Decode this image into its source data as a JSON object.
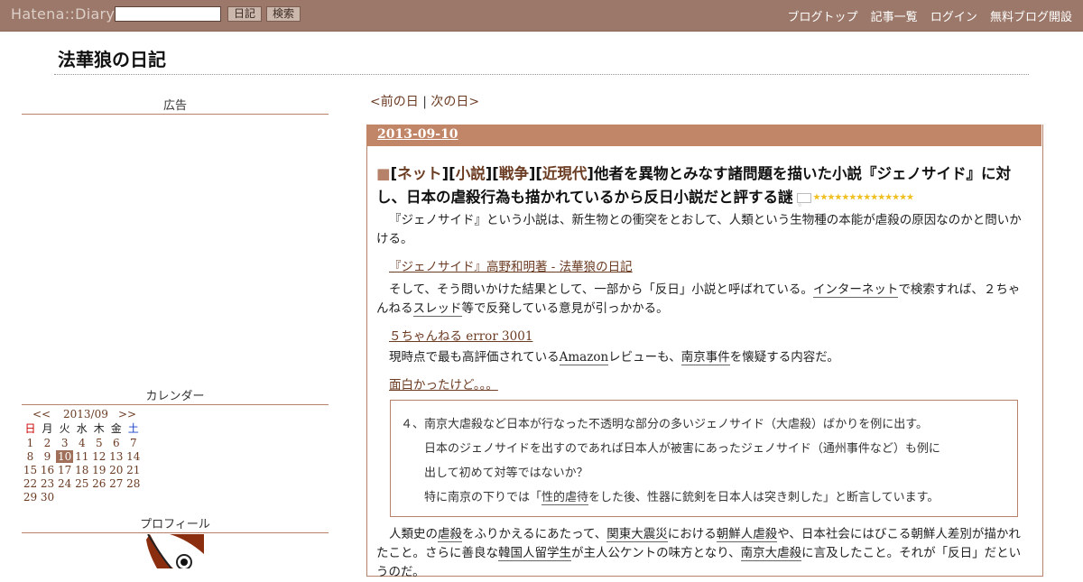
{
  "header": {
    "logo": "Hatena::Diary",
    "diary_button": "日記",
    "search_button": "検索",
    "links": [
      "ブログトップ",
      "記事一覧",
      "ログイン",
      "無料ブログ開設"
    ]
  },
  "site_title": "法華狼の日記",
  "sidebar": {
    "ad_heading": "広告",
    "calendar_heading": "カレンダー",
    "profile_heading": "プロフィール",
    "calendar": {
      "prev": "<<",
      "month": "2013/09",
      "next": ">>",
      "weekdays": [
        "日",
        "月",
        "火",
        "水",
        "木",
        "金",
        "土"
      ],
      "weeks": [
        [
          "1",
          "2",
          "3",
          "4",
          "5",
          "6",
          "7"
        ],
        [
          "8",
          "9",
          "10",
          "11",
          "12",
          "13",
          "14"
        ],
        [
          "15",
          "16",
          "17",
          "18",
          "19",
          "20",
          "21"
        ],
        [
          "22",
          "23",
          "24",
          "25",
          "26",
          "27",
          "28"
        ],
        [
          "29",
          "30",
          "",
          "",
          "",
          "",
          ""
        ]
      ],
      "today": "10"
    }
  },
  "daynav": {
    "prev": "<前の日",
    "sep": "|",
    "next": "次の日>"
  },
  "entry": {
    "date": "2013-09-10",
    "categories": [
      "ネット",
      "小説",
      "戦争",
      "近現代"
    ],
    "title": "他者を異物とみなす諸問題を描いた小説『ジェノサイド』に対し、日本の虐殺行為も描かれているから反日小説だと評する謎",
    "stars": "★★★★★★★★★★★★★★",
    "paragraphs": {
      "p1": "『ジェノサイド』という小説は、新生物との衝突をとおして、人類という生物種の本能が虐殺の原因なのかと問いかける。",
      "link1": "『ジェノサイド』高野和明著 - 法華狼の日記",
      "p2a": "そして、そう問いかけた結果として、一部から「反日」小説と呼ばれている。",
      "p2b": "インターネット",
      "p2c": "で検索すれば、２ちゃんねる",
      "p2d": "スレッド",
      "p2e": "等で反発している意見が引っかかる。",
      "link2": "５ちゃんねる error 3001",
      "p3a": "現時点で最も高評価されている",
      "p3b": "Amazon",
      "p3c": "レビューも、",
      "p3d": "南京事件",
      "p3e": "を懐疑する内容だ。",
      "link3": "面白かったけど。。。",
      "p4a": "人類史の",
      "p4b": "虐殺",
      "p4c": "をふりかえるにあたって、",
      "p4d": "関東大震災",
      "p4e": "における",
      "p4f": "朝鮮人虐殺",
      "p4g": "や、日本社会にはびこる朝鮮人差別が描かれたこと。さらに善良な",
      "p4h": "韓国人",
      "p4i": "留学生",
      "p4j": "が主人公ケントの味方となり、",
      "p4k": "南京大虐殺",
      "p4l": "に言及したこと。それが「反日」だというのだ。"
    },
    "quote": {
      "l1": "４、南京大虐殺など日本が行なった不透明な部分の多いジェノサイド（大虐殺）ばかりを例に出す。",
      "l2": "日本のジェノサイドを出すのであれば日本人が被害にあったジェノサイド（通州事件など）も例に",
      "l3": "出して初めて対等ではないか？",
      "l4a": "特に南京の下りでは「",
      "l4b": "性的虐待",
      "l4c": "をした後、性器に銃剣を日本人は突き刺した」と断言しています。"
    }
  },
  "colors": {
    "topbar": "#9b786a",
    "date_bar": "#c18567",
    "link": "#6b3b22",
    "accent_border": "#b7826a"
  }
}
